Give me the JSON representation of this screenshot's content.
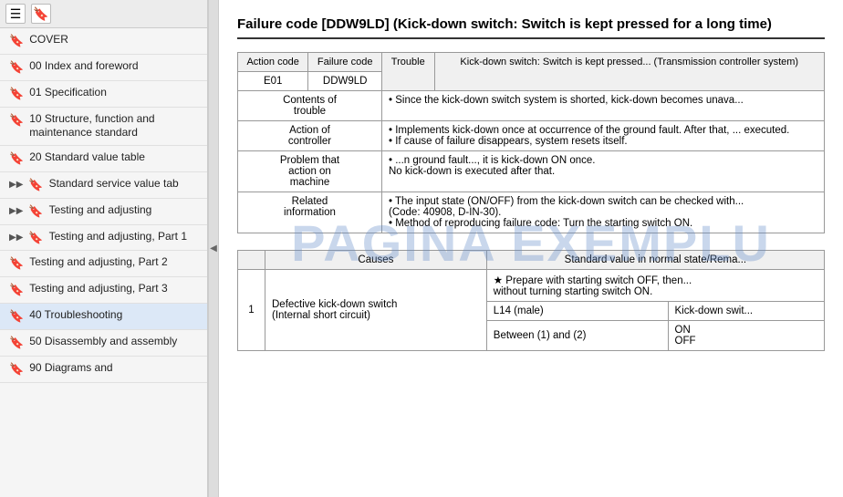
{
  "sidebar": {
    "toolbar": {
      "menu_icon": "☰",
      "bookmark_icon": "🔖"
    },
    "items": [
      {
        "id": "cover",
        "label": "COVER",
        "hasArrow": false,
        "level": 0
      },
      {
        "id": "00-index",
        "label": "00 Index and foreword",
        "hasArrow": false,
        "level": 0
      },
      {
        "id": "01-spec",
        "label": "01 Specification",
        "hasArrow": false,
        "level": 0
      },
      {
        "id": "10-structure",
        "label": "10 Structure, function and maintenance standard",
        "hasArrow": false,
        "level": 0
      },
      {
        "id": "20-standard",
        "label": "20 Standard value table",
        "hasArrow": false,
        "level": 0
      },
      {
        "id": "standard-service",
        "label": "Standard service value tab",
        "hasArrow": true,
        "open": false,
        "level": 0
      },
      {
        "id": "testing-adj",
        "label": "Testing and adjusting",
        "hasArrow": true,
        "open": false,
        "level": 0
      },
      {
        "id": "testing-adj-1",
        "label": "Testing and adjusting, Part 1",
        "hasArrow": true,
        "open": false,
        "level": 0
      },
      {
        "id": "testing-adj-2",
        "label": "Testing and adjusting, Part 2",
        "hasArrow": false,
        "level": 0
      },
      {
        "id": "testing-adj-3",
        "label": "Testing and adjusting, Part 3",
        "hasArrow": false,
        "level": 0
      },
      {
        "id": "40-troubleshooting",
        "label": "40 Troubleshooting",
        "hasArrow": false,
        "level": 0,
        "active": true
      },
      {
        "id": "50-disassembly",
        "label": "50 Disassembly and assembly",
        "hasArrow": false,
        "level": 0
      },
      {
        "id": "90-diagrams",
        "label": "90 Diagrams and",
        "hasArrow": false,
        "level": 0
      }
    ]
  },
  "main": {
    "title": "Failure code [DDW9LD] (Kick-down switch: Switch is kept pressed for a long time)",
    "title_short": "Failure code [DDW9LD] (Kick-down switch: Switch is ke...\nlong time)",
    "table1": {
      "headers": [
        "Action code",
        "Failure code",
        "Trouble"
      ],
      "trouble_desc": "Kick-down switch: Switch is kept pressed... (Transmission controller system)",
      "action_code": "E01",
      "failure_code": "DDW9LD",
      "trouble_label": "Trouble",
      "rows": [
        {
          "label": "Contents of trouble",
          "content": "Since the kick-down switch system is shorted, kick-down becomes unava..."
        },
        {
          "label": "Action of controller",
          "content": "Implements kick-down once at occurrence of the ground fault. After that, ...\nexecuted.\nIf cause of failure disappears, system resets itself."
        },
        {
          "label": "Problem that action on machine",
          "content": "...n ground fault..., it is kick-down ON once.\nNo kick-down is executed after that."
        },
        {
          "label": "Related information",
          "content": "The input state (ON/OFF) from the kick-down switch can be checked with...\n(Code: 40908, D-IN-30).\nMethod of reproducing failure code: Turn the starting switch ON."
        }
      ]
    },
    "table2": {
      "headers": [
        "",
        "Causes",
        "Standard value in normal state/Rema..."
      ],
      "note": "★ Prepare with starting switch OFF, then...\nwithout turning starting switch ON.",
      "rows": [
        {
          "num": "1",
          "cause": "Defective kick-down switch\n(Internal short circuit)",
          "sub_rows": [
            {
              "connector": "L14 (male)",
              "value": "Kick-down swit..."
            },
            {
              "connector": "Between (1) and (2)",
              "value": "ON"
            },
            {
              "connector": "",
              "value": "OFF"
            }
          ]
        }
      ]
    }
  },
  "watermark": "PAGINA EXEMPLU"
}
